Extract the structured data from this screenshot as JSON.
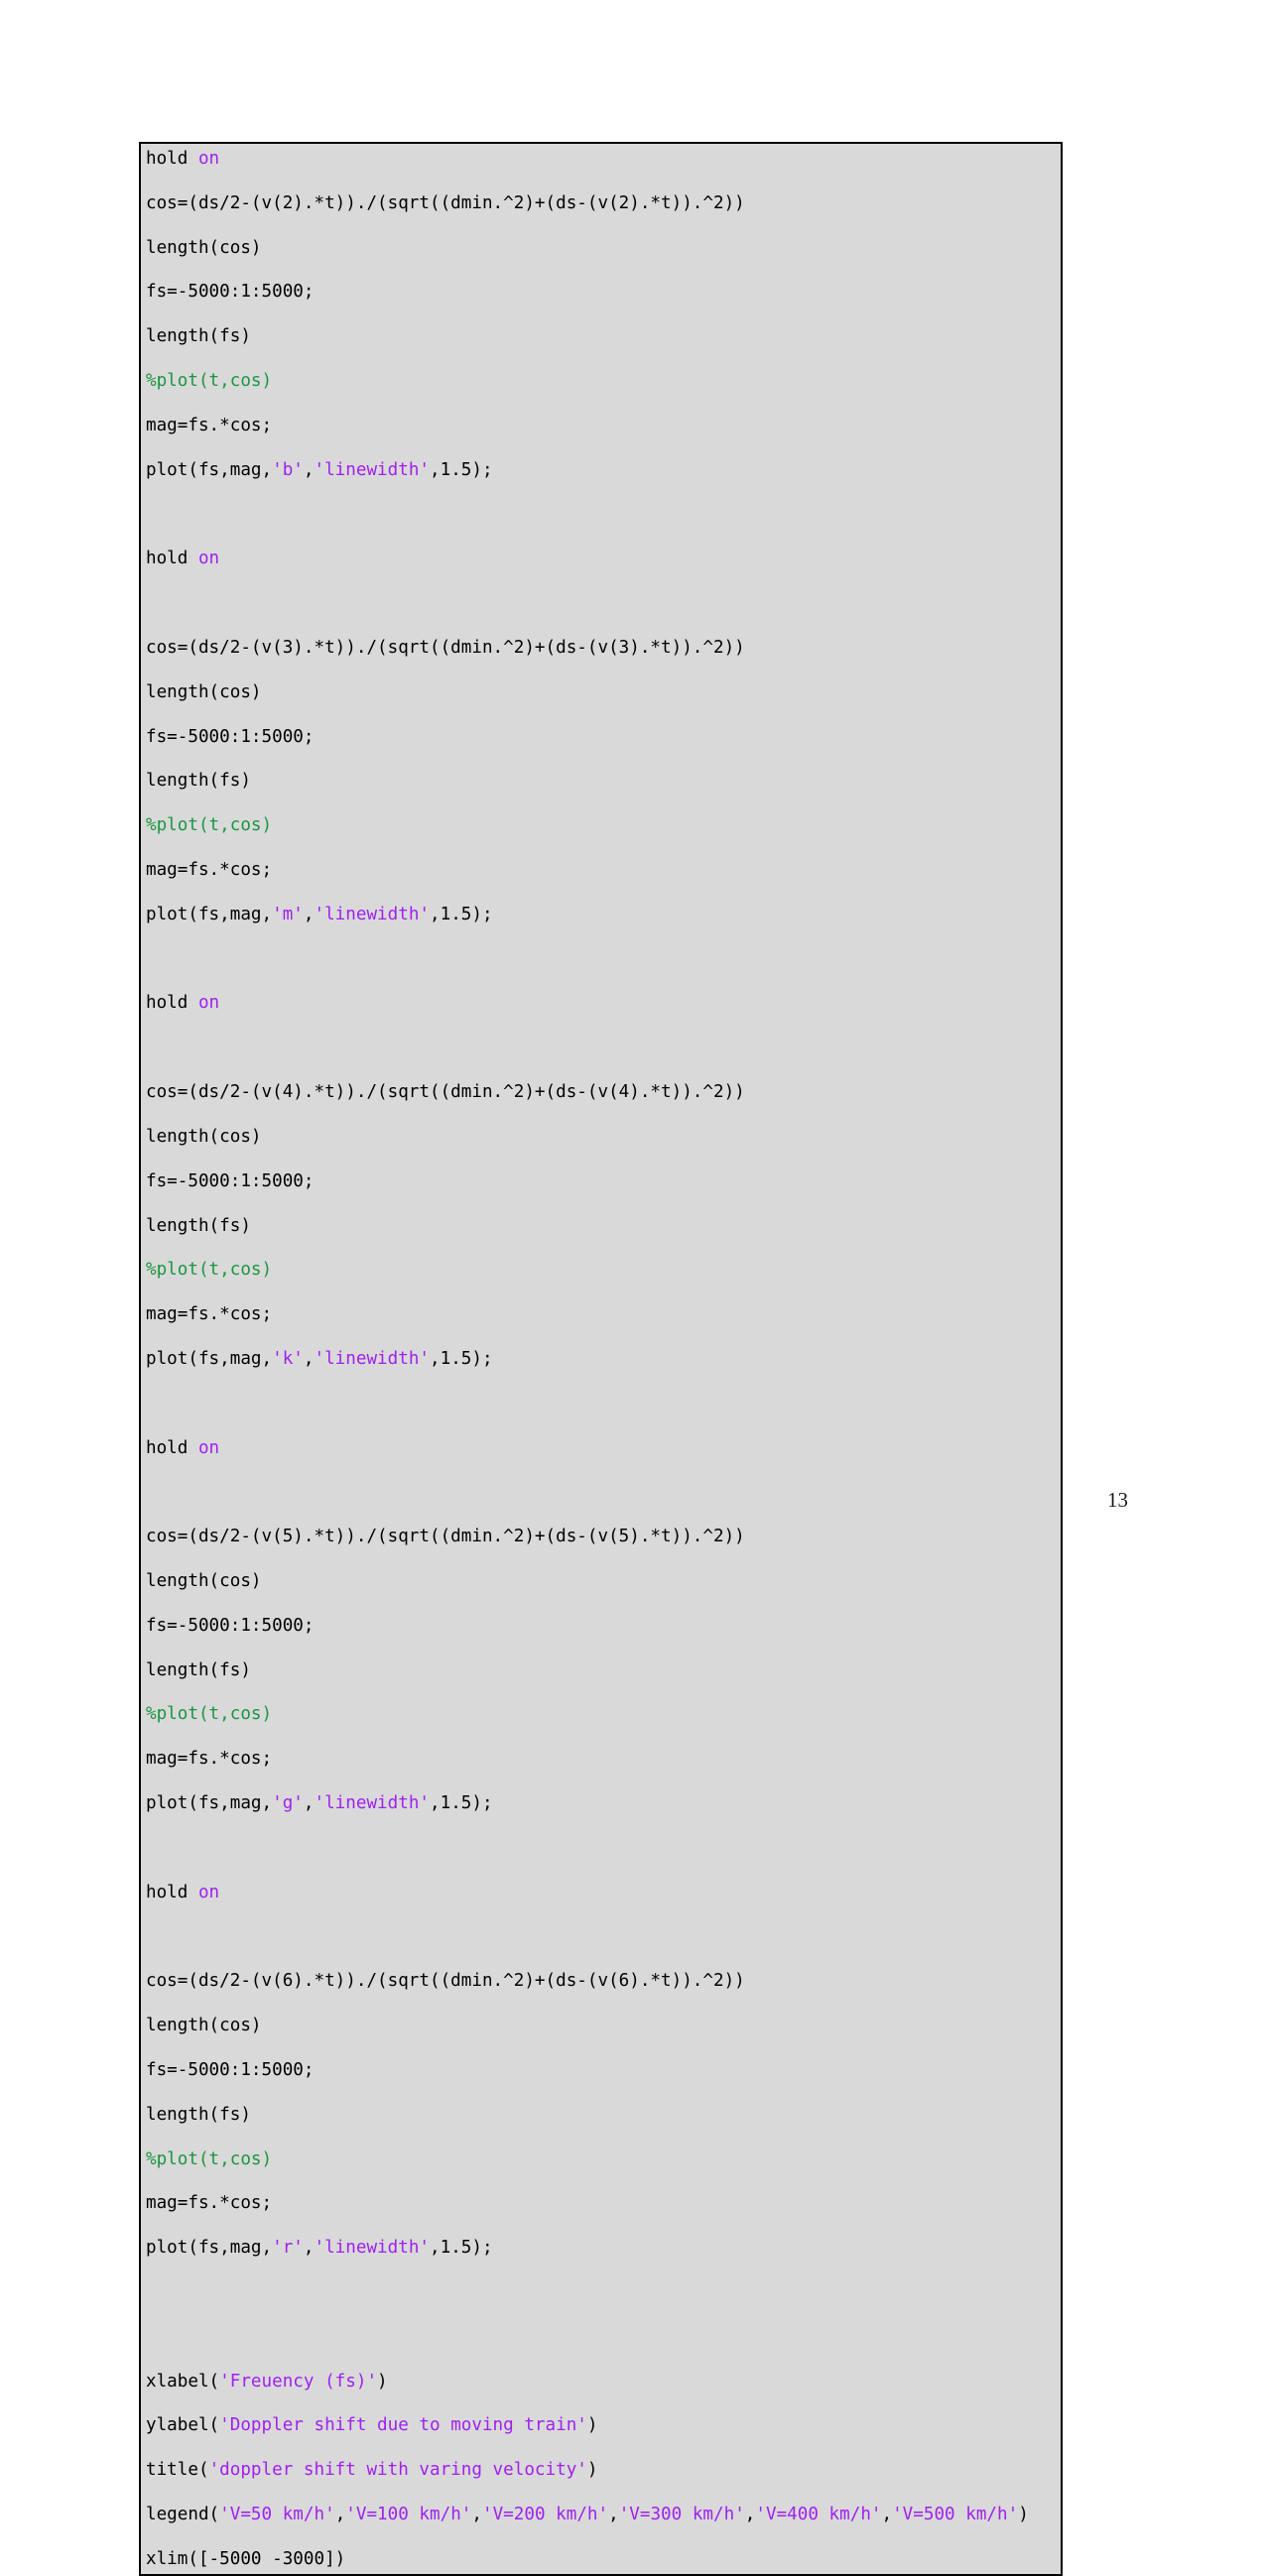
{
  "document": {
    "page_number": "13",
    "background_color": "#ffffff",
    "code_block": {
      "background_color": "#d9d9d9",
      "border_color": "#000000",
      "colors": {
        "plain": "#000000",
        "keyword": "#a020f0",
        "string": "#a020f0",
        "comment": "#1a9641"
      },
      "language": "matlab",
      "lines": [
        [
          {
            "t": "hold ",
            "c": "plain"
          },
          {
            "t": "on",
            "c": "keyword"
          }
        ],
        [
          {
            "t": "cos=(ds/2-(v(2).*t))./(sqrt((dmin.^2)+(ds-(v(2).*t)).^2))",
            "c": "plain"
          }
        ],
        [
          {
            "t": "length(cos)",
            "c": "plain"
          }
        ],
        [
          {
            "t": "fs=-5000:1:5000;",
            "c": "plain"
          }
        ],
        [
          {
            "t": "length(fs)",
            "c": "plain"
          }
        ],
        [
          {
            "t": "%plot(t,cos)",
            "c": "comment"
          }
        ],
        [
          {
            "t": "mag=fs.*cos;",
            "c": "plain"
          }
        ],
        [
          {
            "t": "plot(fs,mag,",
            "c": "plain"
          },
          {
            "t": "'b'",
            "c": "string"
          },
          {
            "t": ",",
            "c": "plain"
          },
          {
            "t": "'linewidth'",
            "c": "string"
          },
          {
            "t": ",1.5);",
            "c": "plain"
          }
        ],
        [
          {
            "t": "",
            "c": "plain"
          }
        ],
        [
          {
            "t": "hold ",
            "c": "plain"
          },
          {
            "t": "on",
            "c": "keyword"
          }
        ],
        [
          {
            "t": "",
            "c": "plain"
          }
        ],
        [
          {
            "t": "cos=(ds/2-(v(3).*t))./(sqrt((dmin.^2)+(ds-(v(3).*t)).^2))",
            "c": "plain"
          }
        ],
        [
          {
            "t": "length(cos)",
            "c": "plain"
          }
        ],
        [
          {
            "t": "fs=-5000:1:5000;",
            "c": "plain"
          }
        ],
        [
          {
            "t": "length(fs)",
            "c": "plain"
          }
        ],
        [
          {
            "t": "%plot(t,cos)",
            "c": "comment"
          }
        ],
        [
          {
            "t": "mag=fs.*cos;",
            "c": "plain"
          }
        ],
        [
          {
            "t": "plot(fs,mag,",
            "c": "plain"
          },
          {
            "t": "'m'",
            "c": "string"
          },
          {
            "t": ",",
            "c": "plain"
          },
          {
            "t": "'linewidth'",
            "c": "string"
          },
          {
            "t": ",1.5);",
            "c": "plain"
          }
        ],
        [
          {
            "t": "",
            "c": "plain"
          }
        ],
        [
          {
            "t": "hold ",
            "c": "plain"
          },
          {
            "t": "on",
            "c": "keyword"
          }
        ],
        [
          {
            "t": "",
            "c": "plain"
          }
        ],
        [
          {
            "t": "cos=(ds/2-(v(4).*t))./(sqrt((dmin.^2)+(ds-(v(4).*t)).^2))",
            "c": "plain"
          }
        ],
        [
          {
            "t": "length(cos)",
            "c": "plain"
          }
        ],
        [
          {
            "t": "fs=-5000:1:5000;",
            "c": "plain"
          }
        ],
        [
          {
            "t": "length(fs)",
            "c": "plain"
          }
        ],
        [
          {
            "t": "%plot(t,cos)",
            "c": "comment"
          }
        ],
        [
          {
            "t": "mag=fs.*cos;",
            "c": "plain"
          }
        ],
        [
          {
            "t": "plot(fs,mag,",
            "c": "plain"
          },
          {
            "t": "'k'",
            "c": "string"
          },
          {
            "t": ",",
            "c": "plain"
          },
          {
            "t": "'linewidth'",
            "c": "string"
          },
          {
            "t": ",1.5);",
            "c": "plain"
          }
        ],
        [
          {
            "t": "",
            "c": "plain"
          }
        ],
        [
          {
            "t": "hold ",
            "c": "plain"
          },
          {
            "t": "on",
            "c": "keyword"
          }
        ],
        [
          {
            "t": "",
            "c": "plain"
          }
        ],
        [
          {
            "t": "cos=(ds/2-(v(5).*t))./(sqrt((dmin.^2)+(ds-(v(5).*t)).^2))",
            "c": "plain"
          }
        ],
        [
          {
            "t": "length(cos)",
            "c": "plain"
          }
        ],
        [
          {
            "t": "fs=-5000:1:5000;",
            "c": "plain"
          }
        ],
        [
          {
            "t": "length(fs)",
            "c": "plain"
          }
        ],
        [
          {
            "t": "%plot(t,cos)",
            "c": "comment"
          }
        ],
        [
          {
            "t": "mag=fs.*cos;",
            "c": "plain"
          }
        ],
        [
          {
            "t": "plot(fs,mag,",
            "c": "plain"
          },
          {
            "t": "'g'",
            "c": "string"
          },
          {
            "t": ",",
            "c": "plain"
          },
          {
            "t": "'linewidth'",
            "c": "string"
          },
          {
            "t": ",1.5);",
            "c": "plain"
          }
        ],
        [
          {
            "t": "",
            "c": "plain"
          }
        ],
        [
          {
            "t": "hold ",
            "c": "plain"
          },
          {
            "t": "on",
            "c": "keyword"
          }
        ],
        [
          {
            "t": "",
            "c": "plain"
          }
        ],
        [
          {
            "t": "cos=(ds/2-(v(6).*t))./(sqrt((dmin.^2)+(ds-(v(6).*t)).^2))",
            "c": "plain"
          }
        ],
        [
          {
            "t": "length(cos)",
            "c": "plain"
          }
        ],
        [
          {
            "t": "fs=-5000:1:5000;",
            "c": "plain"
          }
        ],
        [
          {
            "t": "length(fs)",
            "c": "plain"
          }
        ],
        [
          {
            "t": "%plot(t,cos)",
            "c": "comment"
          }
        ],
        [
          {
            "t": "mag=fs.*cos;",
            "c": "plain"
          }
        ],
        [
          {
            "t": "plot(fs,mag,",
            "c": "plain"
          },
          {
            "t": "'r'",
            "c": "string"
          },
          {
            "t": ",",
            "c": "plain"
          },
          {
            "t": "'linewidth'",
            "c": "string"
          },
          {
            "t": ",1.5);",
            "c": "plain"
          }
        ],
        [
          {
            "t": "",
            "c": "plain"
          }
        ],
        [
          {
            "t": "",
            "c": "plain"
          }
        ],
        [
          {
            "t": "xlabel(",
            "c": "plain"
          },
          {
            "t": "'Freuency (fs)'",
            "c": "string"
          },
          {
            "t": ")",
            "c": "plain"
          }
        ],
        [
          {
            "t": "ylabel(",
            "c": "plain"
          },
          {
            "t": "'Doppler shift due to moving train'",
            "c": "string"
          },
          {
            "t": ")",
            "c": "plain"
          }
        ],
        [
          {
            "t": "title(",
            "c": "plain"
          },
          {
            "t": "'doppler shift with varing velocity'",
            "c": "string"
          },
          {
            "t": ")",
            "c": "plain"
          }
        ],
        [
          {
            "t": "legend(",
            "c": "plain"
          },
          {
            "t": "'V=50 km/h'",
            "c": "string"
          },
          {
            "t": ",",
            "c": "plain"
          },
          {
            "t": "'V=100 km/h'",
            "c": "string"
          },
          {
            "t": ",",
            "c": "plain"
          },
          {
            "t": "'V=200 km/h'",
            "c": "string"
          },
          {
            "t": ",",
            "c": "plain"
          },
          {
            "t": "'V=300 km/h'",
            "c": "string"
          },
          {
            "t": ",",
            "c": "plain"
          },
          {
            "t": "'V=400 km/h'",
            "c": "string"
          },
          {
            "t": ",",
            "c": "plain"
          },
          {
            "t": "'V=500 km/h'",
            "c": "string"
          },
          {
            "t": ")",
            "c": "plain"
          }
        ],
        [
          {
            "t": "xlim([-5000 -3000])",
            "c": "plain"
          }
        ]
      ]
    }
  }
}
